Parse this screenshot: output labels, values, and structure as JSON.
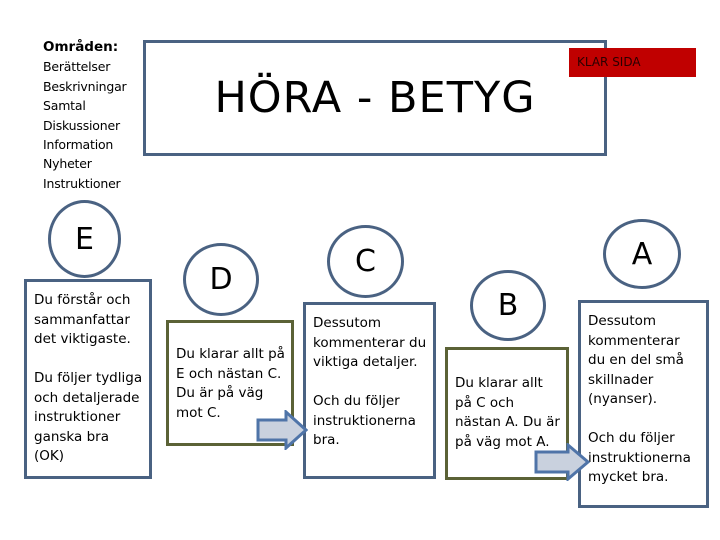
{
  "areas": {
    "heading": "Områden:",
    "items": [
      "Berättelser",
      "Beskrivningar",
      "Samtal",
      "Diskussioner",
      "Information",
      "Nyheter",
      "Instruktioner"
    ]
  },
  "title": "HÖRA - BETYG",
  "klar_button": {
    "label": "KLAR SIDA",
    "color": "#c00000"
  },
  "colors": {
    "blue_border": "#4a6282",
    "olive_border": "#5b6236",
    "arrow_fill": "#c9d1de",
    "arrow_stroke": "#4f74a8"
  },
  "grades": [
    {
      "letter": "E",
      "paragraphs": [
        "Du förstår och sammanfattar det viktigaste.",
        "Du följer tydliga och detaljerade instruktioner ganska bra (OK)"
      ]
    },
    {
      "letter": "D",
      "paragraphs": [
        "Du klarar allt på E och nästan C. Du är på väg mot C."
      ]
    },
    {
      "letter": "C",
      "paragraphs": [
        "Dessutom kommenterar du viktiga detaljer.",
        "Och du följer instruktionerna bra."
      ]
    },
    {
      "letter": "B",
      "paragraphs": [
        "Du klarar allt på C och nästan A. Du är på väg mot A."
      ]
    },
    {
      "letter": "A",
      "paragraphs": [
        "Dessutom kommenterar du en del små skillnader (nyanser).",
        "Och du följer instruktionerna mycket bra."
      ]
    }
  ]
}
